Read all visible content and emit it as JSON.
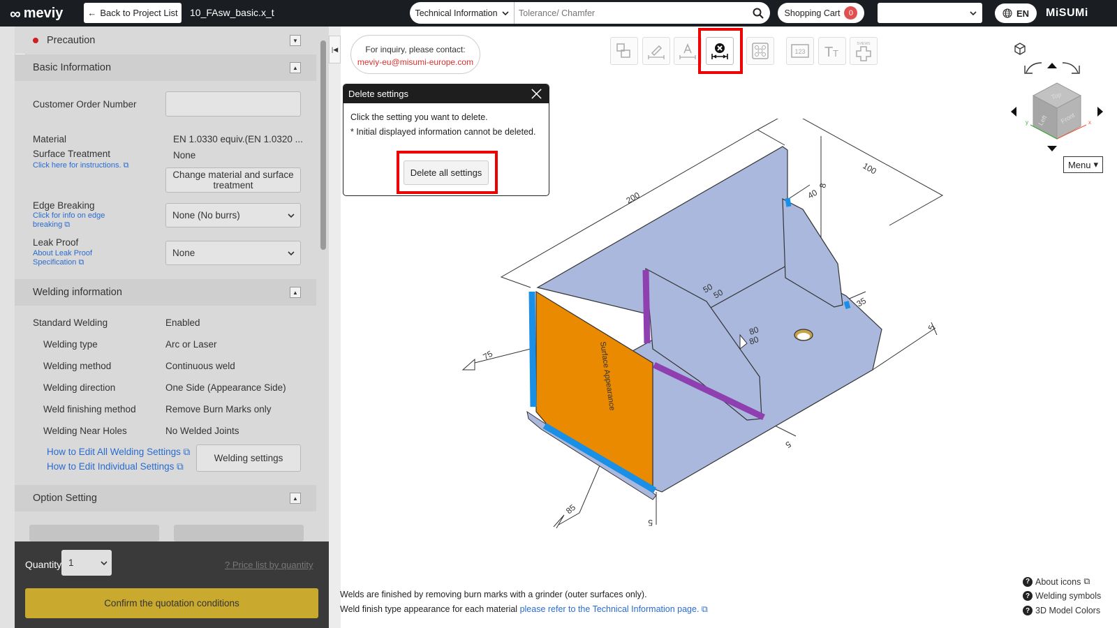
{
  "header": {
    "logo": "meviy",
    "back_label": "Back to Project List",
    "file_name": "10_FAsw_basic.x_t",
    "search_category": "Technical Information",
    "search_placeholder": "Tolerance/ Chamfer",
    "cart_label": "Shopping Cart",
    "cart_count": "0",
    "language": "EN",
    "brand": "MiSUMi"
  },
  "sections": {
    "precaution": "Precaution",
    "basic": "Basic Information",
    "welding": "Welding information",
    "option": "Option Setting"
  },
  "basic": {
    "customer_order_label": "Customer Order Number",
    "customer_order_value": "",
    "material_label": "Material",
    "material_value": "EN 1.0330 equiv.(EN 1.0320 ...",
    "surface_label": "Surface Treatment",
    "surface_value": "None",
    "surface_link": "Click here for instructions.",
    "change_button": "Change material and surface treatment",
    "edge_label": "Edge Breaking",
    "edge_link": "Click for info on edge breaking",
    "edge_value": "None (No burrs)",
    "leak_label": "Leak Proof",
    "leak_link": "About Leak Proof Specification",
    "leak_value": "None"
  },
  "welding": {
    "rows": [
      {
        "label": "Standard Welding",
        "value": "Enabled"
      },
      {
        "label": "Welding type",
        "value": "Arc or Laser"
      },
      {
        "label": "Welding method",
        "value": "Continuous weld"
      },
      {
        "label": "Welding direction",
        "value": "One Side (Appearance Side)"
      },
      {
        "label": "Weld finishing method",
        "value": "Remove Burn Marks only"
      },
      {
        "label": "Welding Near Holes",
        "value": "No Welded Joints"
      }
    ],
    "edit_all_link": "How to Edit All Welding Settings",
    "edit_individual_link": "How to Edit Individual Settings",
    "settings_button": "Welding settings"
  },
  "quantity": {
    "label": "Quantity",
    "value": "1",
    "price_link": "Price list by quantity",
    "confirm_button": "Confirm the quotation conditions"
  },
  "inquiry": {
    "line1": "For inquiry, please contact:",
    "email": "meviy-eu@misumi-europe.com"
  },
  "dialog": {
    "title": "Delete settings",
    "line1": "Click the setting you want to delete.",
    "line2": "* Initial displayed information cannot be deleted.",
    "delete_all": "Delete all settings"
  },
  "viewer": {
    "menu_label": "Menu",
    "cube_faces": {
      "top": "Top",
      "left": "Left",
      "front": "Front"
    },
    "dims": {
      "d200": "200",
      "d100": "100",
      "d40": "40",
      "d8": "8",
      "d50a": "50",
      "d50b": "50",
      "d35": "35",
      "d80a": "80",
      "d80b": "80",
      "d75": "75",
      "d85": "85",
      "d5a": "5",
      "d5b": "5",
      "d5c": "5"
    },
    "surface_text": "Surface Appearance",
    "toolbar_label": "5VIEWS"
  },
  "notes": {
    "line1": "Welds are finished by removing burn marks with a grinder (outer surfaces only).",
    "line2_prefix": "Weld finish type appearance for each material ",
    "line2_link": "please refer to the Technical Information page."
  },
  "help": {
    "about_icons": "About icons",
    "welding_symbols": "Welding symbols",
    "model_colors": "3D Model Colors"
  },
  "colors": {
    "header_bg": "#1a1d22",
    "panel_bg": "#d9d9d9",
    "confirm_bg": "#c9a92e",
    "link": "#2a6bd0",
    "highlight": "#ee0000",
    "part_face": "#a9b8dc",
    "surface_face": "#e98a00",
    "weld_blue": "#1a8fe6",
    "weld_purple": "#8e3fb0"
  }
}
